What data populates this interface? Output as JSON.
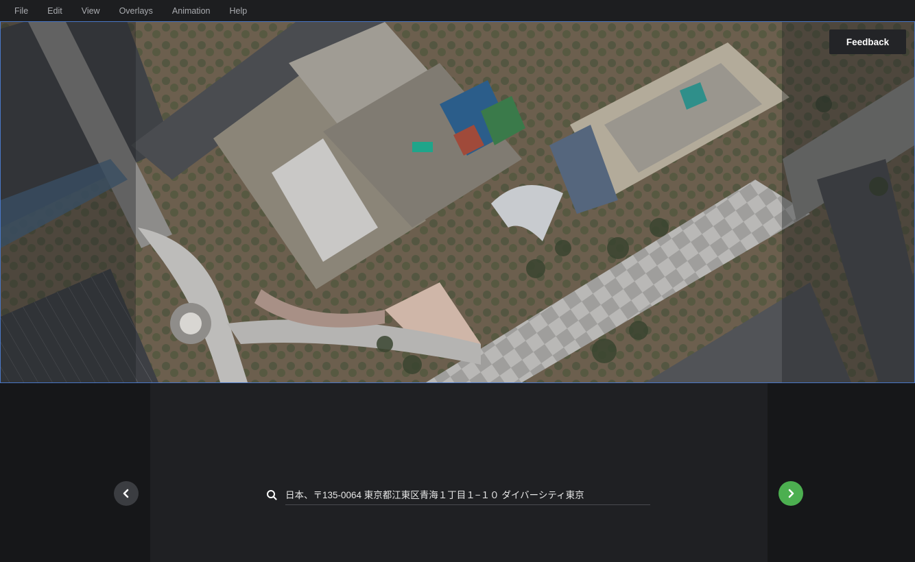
{
  "menu": [
    "File",
    "Edit",
    "View",
    "Overlays",
    "Animation",
    "Help"
  ],
  "feedback_label": "Feedback",
  "search": {
    "value": "日本、〒135-0064 東京都江東区青海１丁目１−１０ ダイバーシティ東京"
  },
  "colors": {
    "accent_next": "#4caf50",
    "selection_border": "#4a78c8"
  },
  "icons": {
    "prev": "chevron-left-icon",
    "next": "chevron-right-icon",
    "search": "search-icon"
  }
}
